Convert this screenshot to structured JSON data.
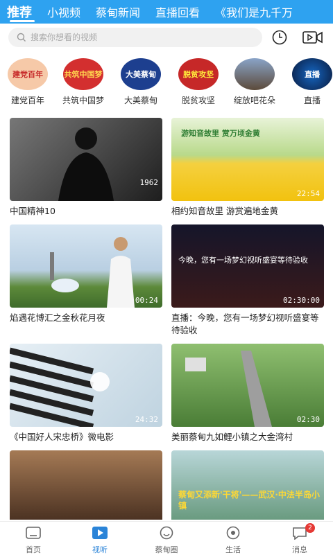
{
  "tabs": [
    {
      "label": "推荐",
      "active": true
    },
    {
      "label": "小视频"
    },
    {
      "label": "蔡甸新闻"
    },
    {
      "label": "直播回看"
    },
    {
      "label": "《我们是九千万"
    }
  ],
  "search": {
    "placeholder": "搜索你想看的视频"
  },
  "icons": {
    "history": "clock-icon",
    "video": "video-camera-icon"
  },
  "categories": [
    {
      "label": "建党百年",
      "art_text": "建党百年",
      "color": "#f6c9a8"
    },
    {
      "label": "共筑中国梦",
      "art_text": "共筑中国梦",
      "color": "#d32f2f"
    },
    {
      "label": "大美蔡甸",
      "art_text": "大美蔡甸",
      "color": "#1d3f8f"
    },
    {
      "label": "脱贫攻坚",
      "art_text": "脱贫攻坚",
      "color": "#c62828"
    },
    {
      "label": "绽放吧花朵",
      "art_text": "",
      "color": "#6d7fa3"
    },
    {
      "label": "直播",
      "art_text": "直播",
      "color": "#0d47a1"
    }
  ],
  "videos": [
    {
      "title": "中国精神10",
      "duration": "",
      "overlay": "1962",
      "colors": [
        "#555",
        "#222"
      ]
    },
    {
      "title": "相约知音故里 游赏遍地金黄",
      "duration": "22:54",
      "overlay": "游知音故里  赏万顷金黄",
      "colors": [
        "#9ccc65",
        "#f4d03f"
      ]
    },
    {
      "title": "焰遇花博汇之金秋花月夜",
      "duration": "00:24",
      "overlay": "",
      "colors": [
        "#c5d8e8",
        "#5d8a3a"
      ]
    },
    {
      "title": "直播：今晚，您有一场梦幻视听盛宴等待验收",
      "duration": "02:30:00",
      "overlay": "今晚，您有一场梦幻视听盛宴等待验收",
      "colors": [
        "#1a1a2e",
        "#6b1e1e"
      ]
    },
    {
      "title": "《中国好人宋忠桥》微电影",
      "duration": "24:32",
      "overlay": "",
      "colors": [
        "#cfe3f0",
        "#2b2b2b"
      ]
    },
    {
      "title": "美丽蔡甸九如鲤小镇之大金湾村",
      "duration": "02:30",
      "overlay": "",
      "colors": [
        "#7aa65a",
        "#3d6b2f"
      ]
    },
    {
      "title": "",
      "duration": "",
      "overlay": "",
      "colors": [
        "#8b5a3c",
        "#3a2418"
      ]
    },
    {
      "title": "",
      "duration": "",
      "overlay": "蔡甸又添新'干将'——武汉·中法半岛小镇",
      "colors": [
        "#9fc4c8",
        "#5a8f6e"
      ]
    }
  ],
  "bottom_nav": [
    {
      "label": "首页",
      "icon": "home-icon"
    },
    {
      "label": "视听",
      "icon": "play-icon",
      "active": true
    },
    {
      "label": "蔡甸圈",
      "icon": "circle-face-icon"
    },
    {
      "label": "生活",
      "icon": "eye-icon"
    },
    {
      "label": "消息",
      "icon": "message-icon",
      "badge": "2"
    }
  ]
}
